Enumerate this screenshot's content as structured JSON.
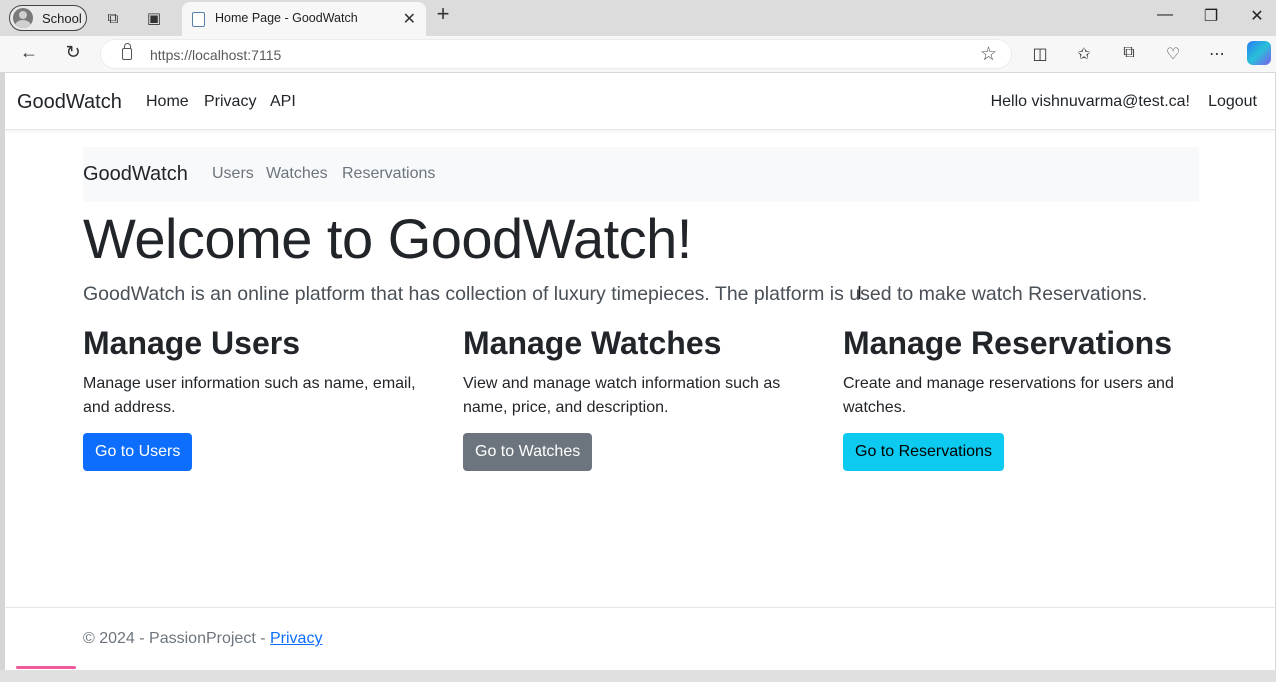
{
  "browser": {
    "profile_label": "School",
    "tab_title": "Home Page - GoodWatch",
    "url_host": "https://localhost",
    "url_port": ":7115"
  },
  "app": {
    "brand": "GoodWatch",
    "nav": [
      "Home",
      "Privacy",
      "API"
    ],
    "greeting": "Hello vishnuvarma@test.ca!",
    "logout": "Logout"
  },
  "subnav": {
    "brand": "GoodWatch",
    "links": [
      "Users",
      "Watches",
      "Reservations"
    ]
  },
  "hero": {
    "title": "Welcome to GoodWatch!",
    "lead": "GoodWatch is an online platform that has collection of luxury timepieces. The platform is used to make watch Reservations."
  },
  "cards": [
    {
      "title": "Manage Users",
      "text": "Manage user information such as name, email, and address.",
      "button": "Go to Users"
    },
    {
      "title": "Manage Watches",
      "text": "View and manage watch information such as name, price, and description.",
      "button": "Go to Watches"
    },
    {
      "title": "Manage Reservations",
      "text": "Create and manage reservations for users and watches.",
      "button": "Go to Reservations"
    }
  ],
  "footer": {
    "text": "© 2024 - PassionProject - ",
    "link": "Privacy"
  }
}
